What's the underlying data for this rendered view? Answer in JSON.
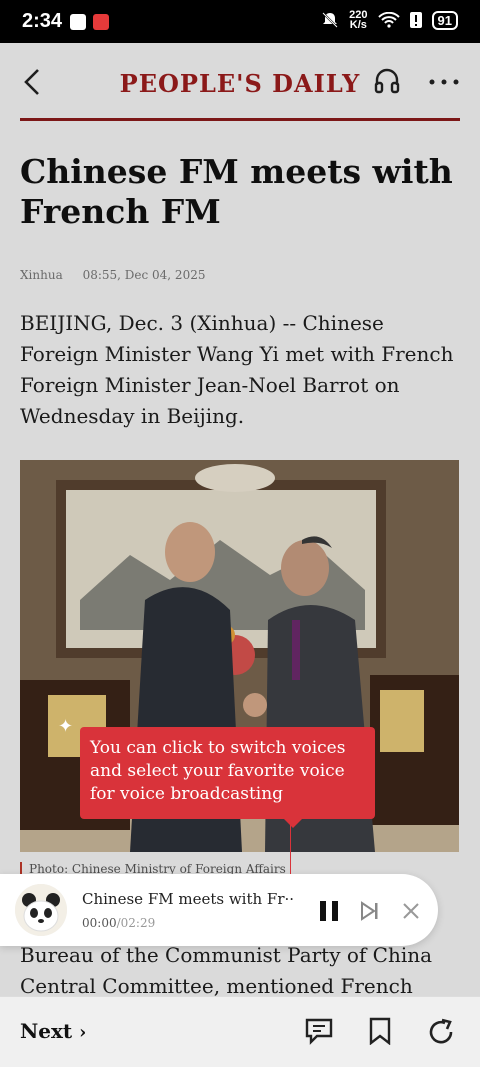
{
  "status_bar": {
    "time": "2:34",
    "speed_value": "220",
    "speed_unit": "K/s",
    "battery": "91"
  },
  "header": {
    "logo": "PEOPLE'S DAILY",
    "back_icon": "chevron-left-icon",
    "listen_icon": "headphones-icon",
    "more_icon": "more-horizontal-icon"
  },
  "article": {
    "title": "Chinese FM meets with French FM",
    "source": "Xinhua",
    "datetime": "08:55, Dec 04, 2025",
    "lead": "BEIJING, Dec. 3 (Xinhua) -- Chinese Foreign Minister Wang Yi met with French Foreign Minister Jean-Noel Barrot on Wednesday in Beijing.",
    "photo_caption": "Photo: Chinese Ministry of Foreign Affairs",
    "paragraph2": "Bureau of the Communist Party of China Central Committee, mentioned French"
  },
  "tooltip": {
    "text": "You can click to switch voices and select your favorite voice for voice broadcasting"
  },
  "player": {
    "title": "Chinese FM meets with Fr··",
    "current_time": "00:00",
    "total_time": "/02:29"
  },
  "bottom_bar": {
    "next_label": "Next",
    "comment_icon": "comment-icon",
    "bookmark_icon": "bookmark-icon",
    "share_icon": "share-icon"
  },
  "colors": {
    "brand_red": "#9b1c1c",
    "tooltip_red": "#d9333a"
  }
}
